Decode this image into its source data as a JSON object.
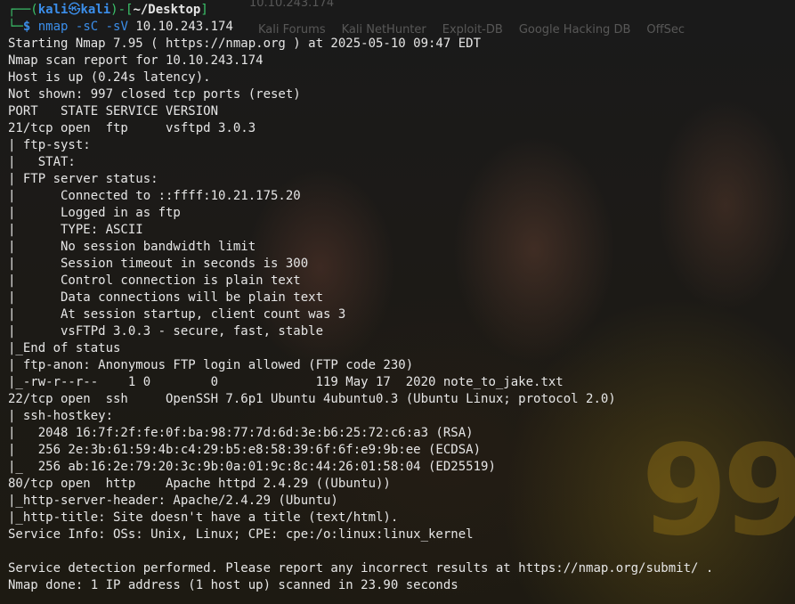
{
  "terminal": {
    "background_tabs": [
      "Kali Forums",
      "Kali NetHunter",
      "Exploit-DB",
      "Google Hacking DB",
      "OffSec"
    ],
    "background_url": "10.10.243.174",
    "prompt": {
      "open": "┌──(",
      "user": "kali",
      "at": "㉿",
      "host": "kali",
      "sep": ")-[",
      "dir": "~/Desktop",
      "close": "]",
      "line2": "└─",
      "symbol": "$",
      "command": "nmap",
      "flags": "-sC -sV",
      "target": "10.10.243.174"
    },
    "output": [
      "Starting Nmap 7.95 ( https://nmap.org ) at 2025-05-10 09:47 EDT",
      "Nmap scan report for 10.10.243.174",
      "Host is up (0.24s latency).",
      "Not shown: 997 closed tcp ports (reset)",
      "PORT   STATE SERVICE VERSION",
      "21/tcp open  ftp     vsftpd 3.0.3",
      "| ftp-syst: ",
      "|   STAT: ",
      "| FTP server status:",
      "|      Connected to ::ffff:10.21.175.20",
      "|      Logged in as ftp",
      "|      TYPE: ASCII",
      "|      No session bandwidth limit",
      "|      Session timeout in seconds is 300",
      "|      Control connection is plain text",
      "|      Data connections will be plain text",
      "|      At session startup, client count was 3",
      "|      vsFTPd 3.0.3 - secure, fast, stable",
      "|_End of status",
      "| ftp-anon: Anonymous FTP login allowed (FTP code 230)",
      "|_-rw-r--r--    1 0        0             119 May 17  2020 note_to_jake.txt",
      "22/tcp open  ssh     OpenSSH 7.6p1 Ubuntu 4ubuntu0.3 (Ubuntu Linux; protocol 2.0)",
      "| ssh-hostkey: ",
      "|   2048 16:7f:2f:fe:0f:ba:98:77:7d:6d:3e:b6:25:72:c6:a3 (RSA)",
      "|   256 2e:3b:61:59:4b:c4:29:b5:e8:58:39:6f:6f:e9:9b:ee (ECDSA)",
      "|_  256 ab:16:2e:79:20:3c:9b:0a:01:9c:8c:44:26:01:58:04 (ED25519)",
      "80/tcp open  http    Apache httpd 2.4.29 ((Ubuntu))",
      "|_http-server-header: Apache/2.4.29 (Ubuntu)",
      "|_http-title: Site doesn't have a title (text/html).",
      "Service Info: OSs: Unix, Linux; CPE: cpe:/o:linux:linux_kernel",
      "",
      "Service detection performed. Please report any incorrect results at https://nmap.org/submit/ .",
      "Nmap done: 1 IP address (1 host up) scanned in 23.90 seconds"
    ]
  }
}
